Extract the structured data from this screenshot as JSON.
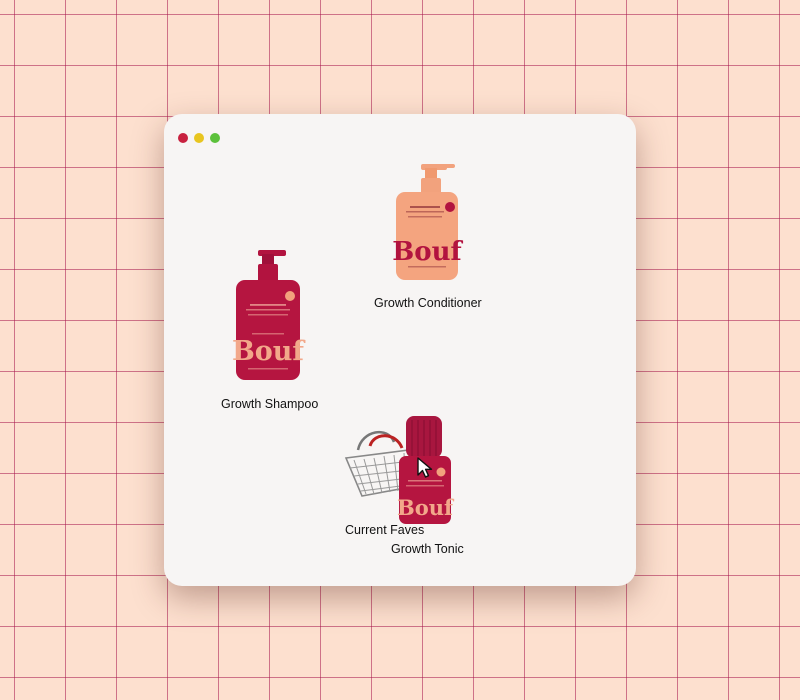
{
  "window": {
    "controls": [
      "close",
      "minimize",
      "maximize"
    ],
    "colors": {
      "close": "#c8213f",
      "minimize": "#e8c51f",
      "maximize": "#5cc13b"
    }
  },
  "desktop": {
    "items": [
      {
        "label": "Growth Conditioner",
        "icon": "conditioner-bottle-icon",
        "brand": "Bouf",
        "color": "#f2a27d"
      },
      {
        "label": "Growth Shampoo",
        "icon": "shampoo-bottle-icon",
        "brand": "Bouf",
        "color": "#b2133f"
      },
      {
        "label": "Current Faves",
        "icon": "shopping-basket-icon"
      },
      {
        "label": "Growth Tonic",
        "icon": "tonic-bottle-icon",
        "brand": "Bouf",
        "color": "#a8163f"
      }
    ]
  },
  "cursor": {
    "icon": "arrow-cursor-icon"
  }
}
